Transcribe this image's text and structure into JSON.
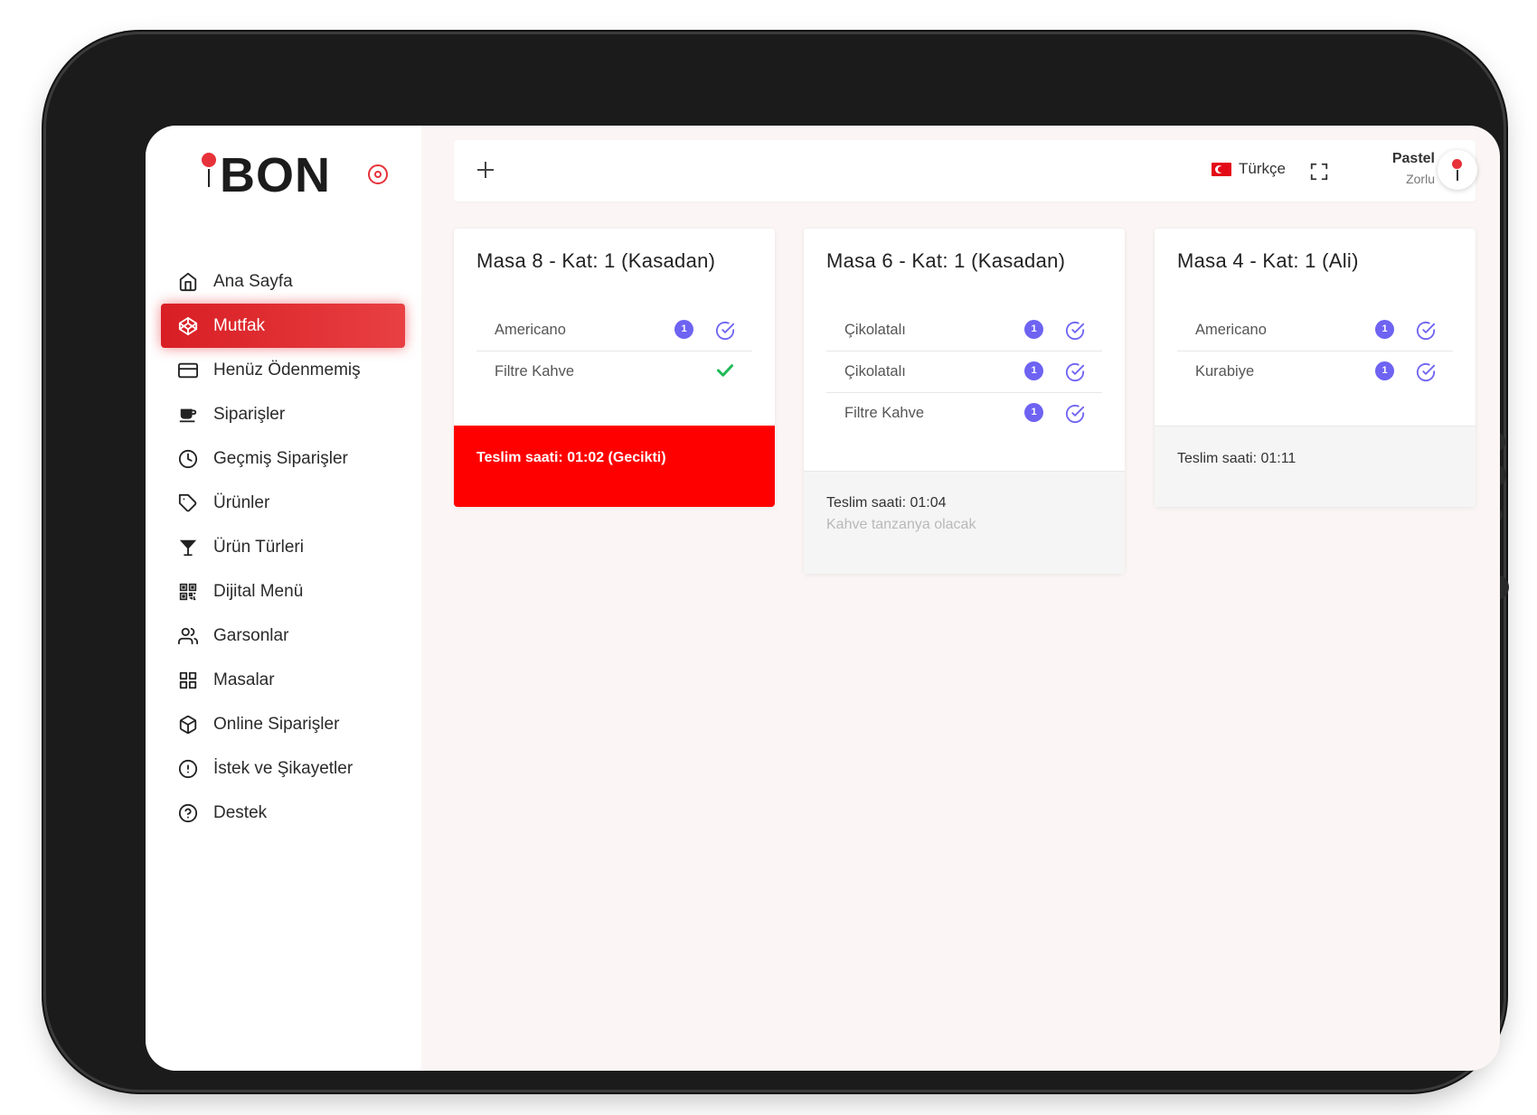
{
  "brand": {
    "logo_text": "BON"
  },
  "sidebar": {
    "items": [
      {
        "label": "Ana Sayfa",
        "icon": "home-icon"
      },
      {
        "label": "Mutfak",
        "icon": "codepen-icon",
        "active": true
      },
      {
        "label": "Henüz Ödenmemiş",
        "icon": "credit-card-icon"
      },
      {
        "label": "Siparişler",
        "icon": "coffee-icon"
      },
      {
        "label": "Geçmiş Siparişler",
        "icon": "clock-icon"
      },
      {
        "label": "Ürünler",
        "icon": "tag-icon"
      },
      {
        "label": "Ürün Türleri",
        "icon": "cocktail-icon"
      },
      {
        "label": "Dijital Menü",
        "icon": "qr-code-icon"
      },
      {
        "label": "Garsonlar",
        "icon": "users-icon"
      },
      {
        "label": "Masalar",
        "icon": "grid-icon"
      },
      {
        "label": "Online Siparişler",
        "icon": "box-icon"
      },
      {
        "label": "İstek ve Şikayetler",
        "icon": "alert-circle-icon"
      },
      {
        "label": "Destek",
        "icon": "help-circle-icon"
      }
    ]
  },
  "topbar": {
    "language": "Türkçe",
    "user_name": "Pastel",
    "user_subtitle": "Zorlu"
  },
  "orders": [
    {
      "title": "Masa 8 - Kat: 1 (Kasadan)",
      "items": [
        {
          "name": "Americano",
          "qty": "1",
          "done": false
        },
        {
          "name": "Filtre Kahve",
          "done": true
        }
      ],
      "delivery": "Teslim saati: 01:02 (Gecikti)",
      "late": true
    },
    {
      "title": "Masa 6 - Kat: 1 (Kasadan)",
      "items": [
        {
          "name": "Çikolatalı",
          "qty": "1",
          "done": false
        },
        {
          "name": "Çikolatalı",
          "qty": "1",
          "done": false
        },
        {
          "name": "Filtre Kahve",
          "qty": "1",
          "done": false
        }
      ],
      "delivery": "Teslim saati: 01:04",
      "note": "Kahve tanzanya olacak",
      "late": false
    },
    {
      "title": "Masa 4 - Kat: 1 (Ali)",
      "items": [
        {
          "name": "Americano",
          "qty": "1",
          "done": false
        },
        {
          "name": "Kurabiye",
          "qty": "1",
          "done": false
        }
      ],
      "delivery": "Teslim saati: 01:11",
      "late": false
    }
  ],
  "colors": {
    "accent": "#e7323a",
    "late": "#ff0000",
    "badge": "#6e63f2",
    "done": "#1fb956"
  }
}
